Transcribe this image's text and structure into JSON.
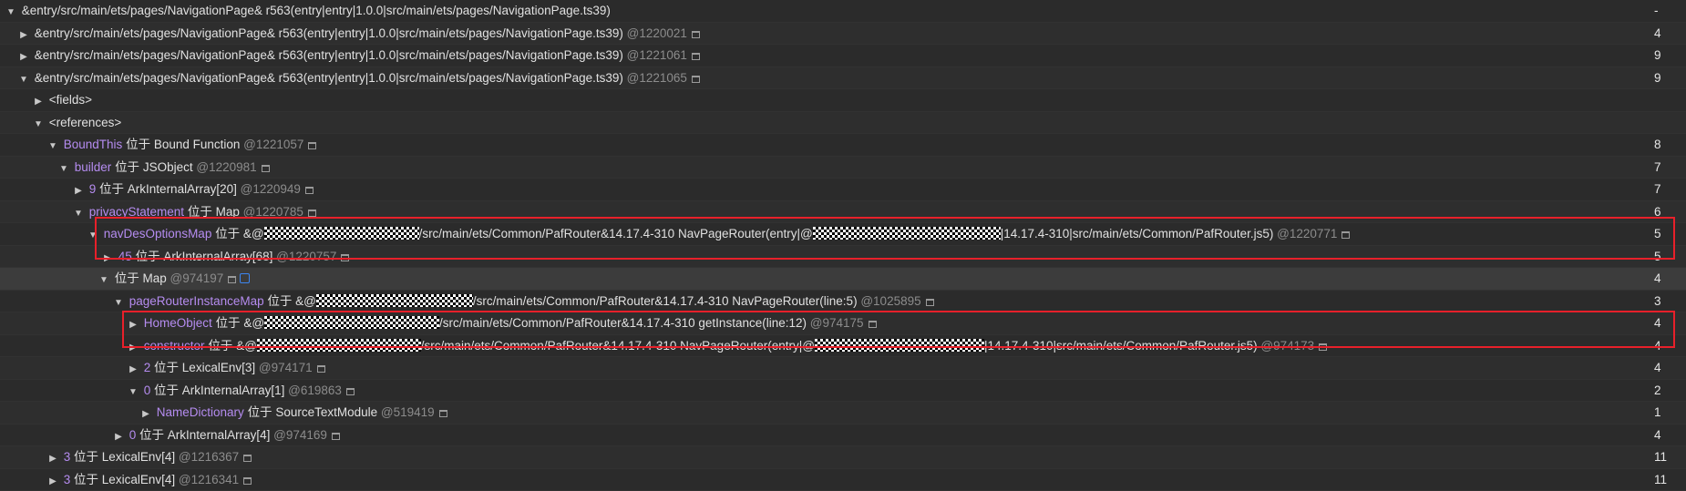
{
  "rows": [
    {
      "t": "&entry/src/main/ets/pages/NavigationPage& r563(entry|entry|1.0.0|src/main/ets/pages/NavigationPage.ts39)",
      "count": "-"
    },
    {
      "t": "&entry/src/main/ets/pages/NavigationPage& r563(entry|entry|1.0.0|src/main/ets/pages/NavigationPage.ts39)",
      "id": "@1220021",
      "count": "4"
    },
    {
      "t": "&entry/src/main/ets/pages/NavigationPage& r563(entry|entry|1.0.0|src/main/ets/pages/NavigationPage.ts39)",
      "id": "@1221061",
      "count": "9"
    },
    {
      "t": "&entry/src/main/ets/pages/NavigationPage& r563(entry|entry|1.0.0|src/main/ets/pages/NavigationPage.ts39)",
      "id": "@1221065",
      "count": "9"
    },
    {
      "t": "<fields>",
      "count": ""
    },
    {
      "t": "<references>",
      "count": ""
    },
    {
      "name": "BoundThis",
      "t": "位于 Bound Function",
      "id": "@1221057",
      "count": "8"
    },
    {
      "name": "builder",
      "t": "位于 JSObject",
      "id": "@1220981",
      "count": "7"
    },
    {
      "name": "9",
      "t": "位于 ArkInternalArray[20]",
      "id": "@1220949",
      "count": "7"
    },
    {
      "name": "privacyStatement",
      "t": "位于 Map",
      "id": "@1220785",
      "count": "6"
    },
    {
      "name": "navDesOptionsMap",
      "t1": "位于 &@",
      "t2": "/src/main/ets/Common/PafRouter&14.17.4-310 NavPageRouter(entry|@",
      "t3": "|14.17.4-310|src/main/ets/Common/PafRouter.js5)",
      "id": "@1220771",
      "count": "5"
    },
    {
      "name": "45",
      "t": "位于 ArkInternalArray[68]",
      "id": "@1220757",
      "count": "5"
    },
    {
      "t": "位于 Map",
      "id": "@974197",
      "count": "4"
    },
    {
      "name": "pageRouterInstanceMap",
      "t1": "位于 &@",
      "t2": "/src/main/ets/Common/PafRouter&14.17.4-310 NavPageRouter(line:5)",
      "id": "@1025895",
      "count": "3"
    },
    {
      "name": "HomeObject",
      "t1": "位于 &@",
      "t2": "/src/main/ets/Common/PafRouter&14.17.4-310 getInstance(line:12)",
      "id": "@974175",
      "count": "4"
    },
    {
      "name": "constructor",
      "t1": "位于 &@",
      "t2": "/src/main/ets/Common/PafRouter&14.17.4-310 NavPageRouter(entry|@",
      "t3": "|14.17.4-310|src/main/ets/Common/PafRouter.js5)",
      "id": "@974173",
      "count": "4"
    },
    {
      "name": "2",
      "t": "位于 LexicalEnv[3]",
      "id": "@974171",
      "count": "4"
    },
    {
      "name": "0",
      "t": "位于 ArkInternalArray[1]",
      "id": "@619863",
      "count": "2"
    },
    {
      "name": "NameDictionary",
      "t": "位于 SourceTextModule",
      "id": "@519419",
      "count": "1"
    },
    {
      "name": "0",
      "t": "位于 ArkInternalArray[4]",
      "id": "@974169",
      "count": "4"
    },
    {
      "name": "3",
      "t": "位于 LexicalEnv[4]",
      "id": "@1216367",
      "count": "11"
    },
    {
      "name": "3",
      "t": "位于 LexicalEnv[4]",
      "id": "@1216341",
      "count": "11"
    }
  ]
}
